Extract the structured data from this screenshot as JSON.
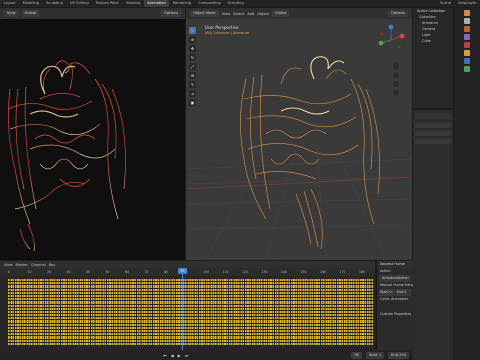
{
  "topbar": {
    "workspaces": [
      "Layout",
      "Modeling",
      "Sculpting",
      "UV Editing",
      "Texture Paint",
      "Shading",
      "Animation",
      "Rendering",
      "Compositing",
      "Scripting"
    ],
    "active_index": 6,
    "scene_label": "Scene",
    "view_layer_label": "ViewLayer"
  },
  "left_view": {
    "view_label": "View",
    "orientation": "Global",
    "options_label": "Options"
  },
  "main_view": {
    "mode_label": "Object Mode",
    "menus": [
      "View",
      "Select",
      "Add",
      "Object"
    ],
    "orientation": "Global",
    "options_label": "Options",
    "overlay_title": "User Perspective",
    "overlay_subtitle": "(80) Collection | Armature"
  },
  "outliner": {
    "title": "Scene Collection",
    "items": [
      "Collection",
      "Armature",
      "Camera",
      "Light",
      "Cube"
    ]
  },
  "timeline": {
    "menus": [
      "View",
      "Marker",
      "Channel",
      "Key"
    ],
    "ticks": [
      "0",
      "10",
      "20",
      "30",
      "40",
      "50",
      "60",
      "70",
      "80",
      "90",
      "100",
      "110",
      "120",
      "130",
      "140",
      "150",
      "160",
      "170",
      "180"
    ],
    "current_frame": "90",
    "start_label": "Start",
    "start_value": "1",
    "end_label": "End",
    "end_value": "250"
  },
  "nla_panel": {
    "title": "Nearest Frame",
    "section_action": "Action",
    "action_name": "ArmatureAction",
    "manual_frame_range": "Manual Frame Range",
    "start_label": "Start",
    "start_value": "0",
    "end_label": "End",
    "end_value": "0",
    "cyclic": "Cyclic Animation",
    "custom_props": "Custom Properties"
  },
  "colors": {
    "accent": "#4a72b0",
    "keyframe": "#e6b820",
    "playhead": "#4a7fd4",
    "wire_orange": "#f0a040"
  }
}
